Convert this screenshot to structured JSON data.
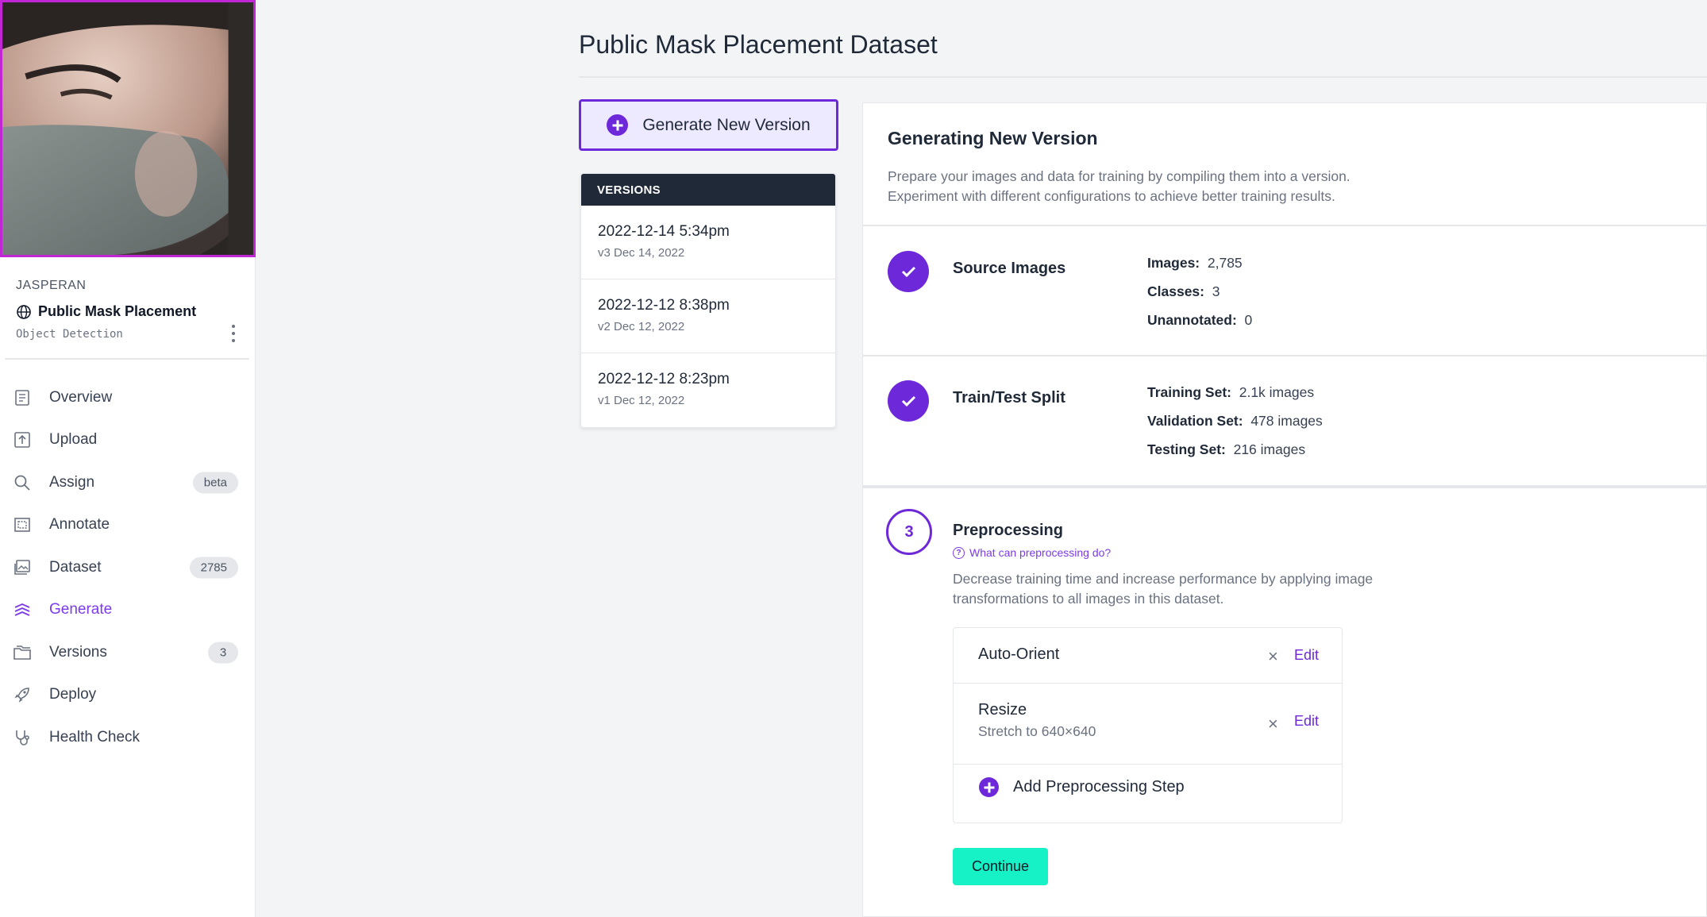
{
  "colors": {
    "accent": "#6d28d9",
    "continue": "#16f2c6",
    "thumb_border": "#c026d3"
  },
  "sidebar": {
    "owner": "JASPERAN",
    "project_name": "Public Mask Placement",
    "project_type": "Object Detection",
    "items": [
      {
        "label": "Overview",
        "icon": "document-icon"
      },
      {
        "label": "Upload",
        "icon": "upload-icon"
      },
      {
        "label": "Assign",
        "icon": "search-icon",
        "badge": "beta"
      },
      {
        "label": "Annotate",
        "icon": "annotate-icon"
      },
      {
        "label": "Dataset",
        "icon": "images-icon",
        "badge": "2785"
      },
      {
        "label": "Generate",
        "icon": "generate-icon",
        "active": true
      },
      {
        "label": "Versions",
        "icon": "folders-icon",
        "badge": "3"
      },
      {
        "label": "Deploy",
        "icon": "rocket-icon"
      },
      {
        "label": "Health Check",
        "icon": "stethoscope-icon"
      }
    ]
  },
  "main": {
    "title": "Public Mask Placement Dataset",
    "generate_button": "Generate New Version",
    "versions_header": "VERSIONS",
    "versions": [
      {
        "date": "2022-12-14 5:34pm",
        "sub": "v3 Dec 14, 2022"
      },
      {
        "date": "2022-12-12 8:38pm",
        "sub": "v2 Dec 12, 2022"
      },
      {
        "date": "2022-12-12 8:23pm",
        "sub": "v1 Dec 12, 2022"
      }
    ]
  },
  "panel": {
    "title": "Generating New Version",
    "desc_line1": "Prepare your images and data for training by compiling them into a version.",
    "desc_line2": "Experiment with different configurations to achieve better training results.",
    "source": {
      "label": "Source Images",
      "stats": [
        {
          "key": "Images:",
          "value": "2,785"
        },
        {
          "key": "Classes:",
          "value": "3"
        },
        {
          "key": "Unannotated:",
          "value": "0"
        }
      ]
    },
    "split": {
      "label": "Train/Test Split",
      "stats": [
        {
          "key": "Training Set:",
          "value": "2.1k images"
        },
        {
          "key": "Validation Set:",
          "value": "478 images"
        },
        {
          "key": "Testing Set:",
          "value": "216 images"
        }
      ]
    },
    "preprocessing": {
      "number": "3",
      "label": "Preprocessing",
      "help": "What can preprocessing do?",
      "desc": "Decrease training time and increase performance by applying image transformations to all images in this dataset.",
      "steps": [
        {
          "name": "Auto-Orient",
          "edit": "Edit",
          "remove": "×"
        },
        {
          "name": "Resize",
          "sub": "Stretch to 640×640",
          "edit": "Edit",
          "remove": "×"
        }
      ],
      "add": "Add Preprocessing Step",
      "continue": "Continue"
    }
  }
}
